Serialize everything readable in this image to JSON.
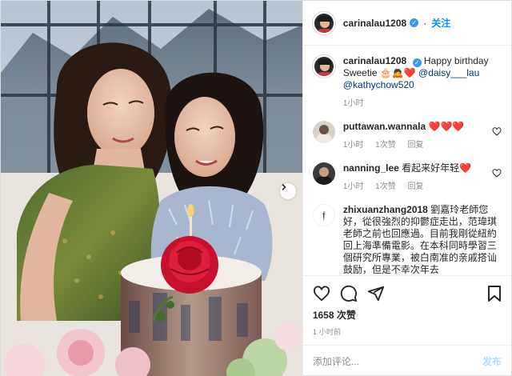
{
  "header": {
    "username": "carinalau1208",
    "follow_label": "关注"
  },
  "caption": {
    "username": "carinalau1208",
    "text": "Happy birthday Sweetie",
    "mention1": "@daisy___lau",
    "mention2": "@kathychow520",
    "time": "1小时"
  },
  "comments": [
    {
      "username": "puttawan.wannala",
      "text": "",
      "time": "1小时",
      "likes": "1次赞",
      "reply": "回复"
    },
    {
      "username": "nanning_lee",
      "text": "看起来好年轻",
      "time": "1小时",
      "likes": "1次赞",
      "reply": "回复"
    },
    {
      "username": "zhixuanzhang2018",
      "text": "劉嘉玲老師您好，從很強烈的抑鬱症走出，范瑋琪老師之前也回應過。目前我剛從紐約回上海準備電影。在本科同時學習三個研究所專業，被白南准的亲戚搭讪鼓励，但是不幸次年去"
    }
  ],
  "actions": {
    "likes": "1658 次赞",
    "time": "1 小时前"
  },
  "add_comment": {
    "placeholder": "添加评论...",
    "post_label": "发布"
  },
  "colors": {
    "accent": "#0095f6",
    "verified": "#3897f0",
    "heart": "#ed4956",
    "muted": "#8e8e8e"
  },
  "icons": [
    "chevron-right-icon",
    "verified-icon",
    "heart-icon",
    "comment-icon",
    "share-icon",
    "bookmark-icon"
  ]
}
